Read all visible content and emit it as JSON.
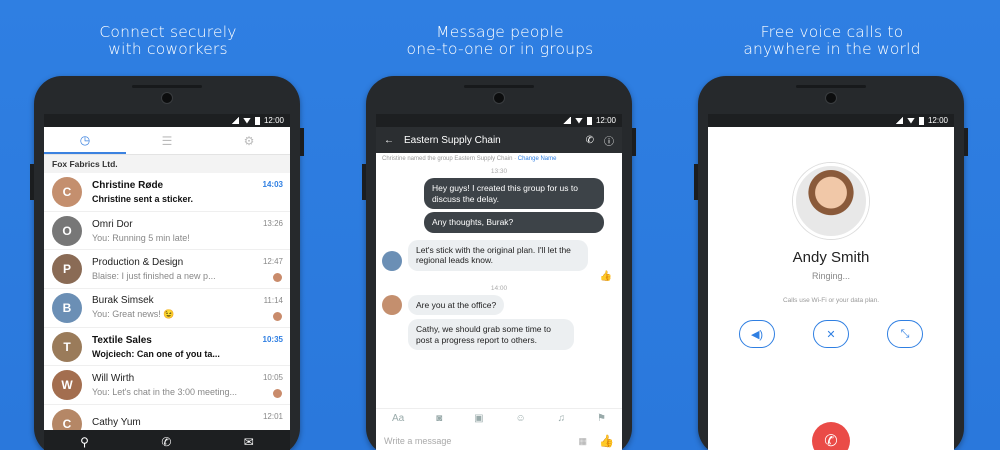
{
  "captions": [
    {
      "line1": "Connect securely",
      "line2": "with coworkers"
    },
    {
      "line1": "Message people",
      "line2": "one-to-one or in groups"
    },
    {
      "line1": "Free voice calls to",
      "line2": "anywhere in the world"
    }
  ],
  "status_time": "12:00",
  "chats_screen": {
    "org_name": "Fox Fabrics Ltd.",
    "chats": [
      {
        "name": "Christine Røde",
        "preview": "Christine sent a sticker.",
        "time": "14:03",
        "unread": true,
        "color": "#c48f6e"
      },
      {
        "name": "Omri Dor",
        "preview": "You: Running 5 min late!",
        "time": "13:26",
        "unread": false,
        "color": "#777777"
      },
      {
        "name": "Production & Design",
        "preview": "Blaise: I just finished a new p...",
        "time": "12:47",
        "unread": false,
        "color": "#8a6b55"
      },
      {
        "name": "Burak Simsek",
        "preview": "You: Great news! 😉",
        "time": "11:14",
        "unread": false,
        "color": "#6b8fb5"
      },
      {
        "name": "Textile Sales",
        "preview": "Wojciech: Can one of you ta...",
        "time": "10:35",
        "unread": true,
        "color": "#9a7b5a"
      },
      {
        "name": "Will Wirth",
        "preview": "You: Let's chat in the 3:00 meeting...",
        "time": "10:05",
        "unread": false,
        "color": "#a36e4f"
      },
      {
        "name": "Cathy Yum",
        "preview": "",
        "time": "12:01",
        "unread": false,
        "color": "#b58766"
      }
    ]
  },
  "thread_screen": {
    "title": "Eastern Supply Chain",
    "system_note": "Christine named the group Eastern Supply Chain",
    "system_link": "Change Name",
    "time1": "13:30",
    "time2": "14:00",
    "msg1": "Hey guys! I created this group for us to discuss the delay.",
    "msg2": "Any thoughts, Burak?",
    "msg3": "Let's stick with the original plan. I'll let the regional leads know.",
    "msg4": "Are you at the office?",
    "msg5": "Cathy, we should grab some time to post a progress report to others.",
    "composer_placeholder": "Write a message"
  },
  "call_screen": {
    "name": "Andy Smith",
    "status": "Ringing...",
    "note": "Calls use Wi-Fi or your data plan."
  }
}
